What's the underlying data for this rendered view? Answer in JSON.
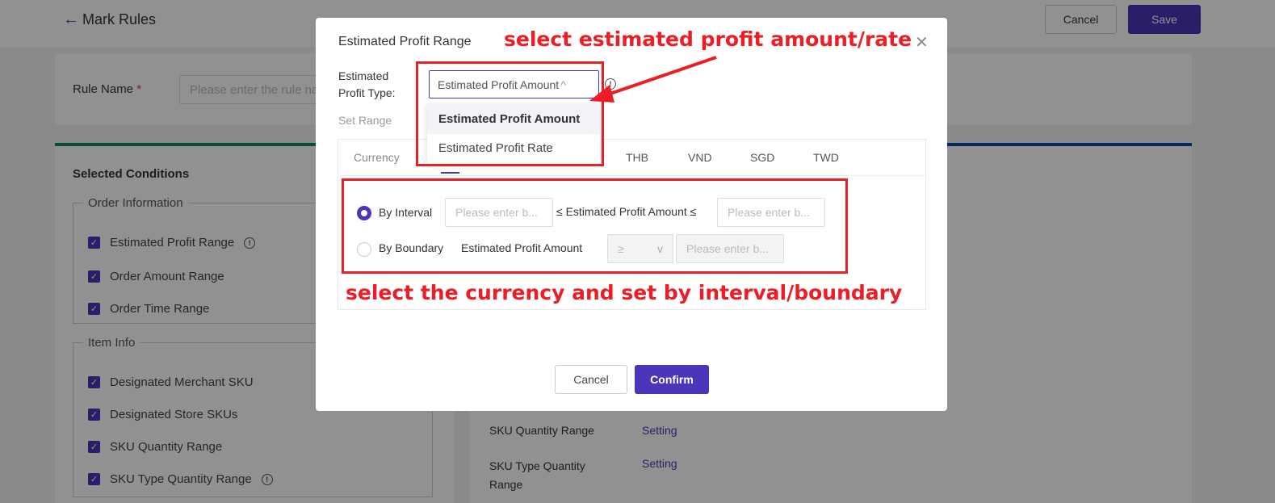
{
  "page": {
    "title": "Mark Rules",
    "cancel": "Cancel",
    "save": "Save",
    "rule_name_label": "Rule Name",
    "required_mark": "*",
    "rule_name_placeholder": "Please enter the rule name",
    "selected_conditions": "Selected Conditions",
    "groups": [
      {
        "title": "Order Information",
        "items": [
          {
            "label": "Estimated Profit Range",
            "info": true
          },
          {
            "label": "Order Amount Range",
            "info": false
          },
          {
            "label": "Order Time Range",
            "info": false
          }
        ]
      },
      {
        "title": "Item Info",
        "items": [
          {
            "label": "Designated Merchant SKU",
            "info": false
          },
          {
            "label": "Designated Store SKUs",
            "info": false
          },
          {
            "label": "SKU Quantity Range",
            "info": false
          },
          {
            "label": "SKU Type Quantity Range",
            "info": true
          }
        ]
      }
    ],
    "settings": [
      {
        "label": "SKU Quantity Range",
        "action": "Setting"
      },
      {
        "label": "SKU Type Quantity Range",
        "action": "Setting"
      }
    ]
  },
  "modal": {
    "title": "Estimated Profit Range",
    "type_label": "Estimated Profit Type:",
    "type_value": "Estimated Profit Amount",
    "options": [
      "Estimated Profit Amount",
      "Estimated Profit Rate"
    ],
    "set_range": "Set Range",
    "currency_label": "Currency",
    "tabs": [
      "THB",
      "VND",
      "SGD",
      "TWD"
    ],
    "by_interval": "By Interval",
    "by_boundary": "By Boundary",
    "interval_middle": "≤ Estimated Profit Amount ≤",
    "boundary_label": "Estimated Profit Amount",
    "boundary_op": "≥",
    "placeholder": "Please enter b...",
    "cancel": "Cancel",
    "confirm": "Confirm"
  },
  "annotations": {
    "top": "select estimated profit amount/rate",
    "bottom": "select the currency and set by interval/boundary"
  },
  "colors": {
    "primary": "#4a36b8",
    "annotation": "#ee1c24"
  }
}
